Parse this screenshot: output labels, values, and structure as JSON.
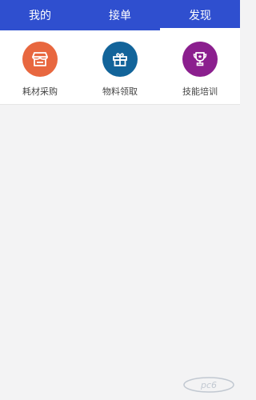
{
  "tabs": [
    {
      "label": "我的",
      "active": false
    },
    {
      "label": "接单",
      "active": false
    },
    {
      "label": "发现",
      "active": true
    }
  ],
  "items": [
    {
      "label": "耗材采购",
      "icon": "store-icon",
      "color": "#e8673f"
    },
    {
      "label": "物料领取",
      "icon": "gift-icon",
      "color": "#12649a"
    },
    {
      "label": "技能培训",
      "icon": "trophy-icon",
      "color": "#8b1f8e"
    }
  ],
  "colors": {
    "header": "#2f4fcf",
    "background": "#f3f3f4"
  },
  "watermark": {
    "text": "pc6"
  }
}
